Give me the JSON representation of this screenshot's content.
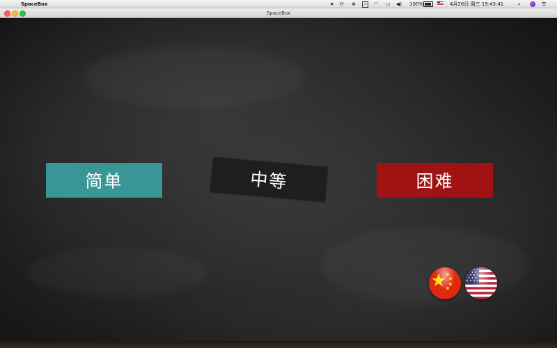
{
  "menubar": {
    "app_name": "SpaceBox",
    "battery": "100%",
    "datetime": "4月26日 周三  19:43:41",
    "icons": [
      "apple-icon",
      "location-arrow-icon",
      "sync-icon",
      "settings-icon",
      "keyboard-icon",
      "wifi-icon",
      "airplay-icon",
      "volume-icon",
      "battery-icon",
      "us-flag-input-icon",
      "search-icon",
      "siri-icon",
      "list-icon"
    ]
  },
  "window": {
    "title": "SpaceBox"
  },
  "menu": {
    "easy_label": "简单",
    "medium_label": "中等",
    "hard_label": "困难"
  },
  "language": {
    "options": [
      "chinese-flag",
      "us-flag"
    ]
  },
  "colors": {
    "easy": "#3a9696",
    "medium": "#1e1e1e",
    "hard": "#a11212",
    "board": "#242424"
  }
}
